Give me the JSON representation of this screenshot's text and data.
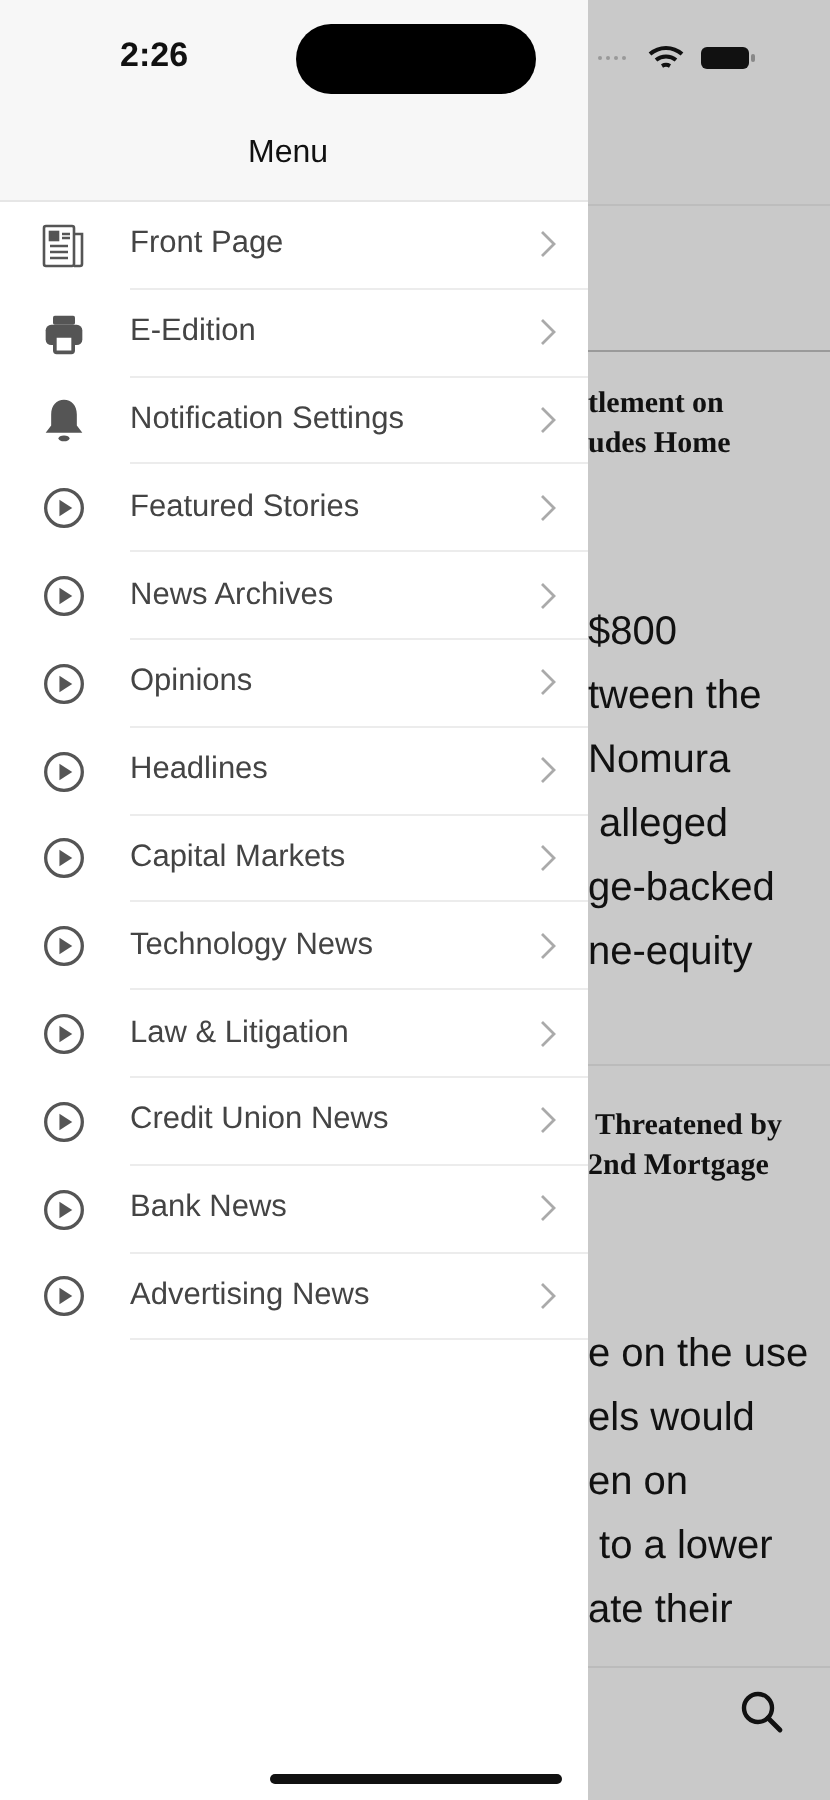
{
  "status_bar": {
    "time": "2:26"
  },
  "menu": {
    "title": "Menu",
    "items": [
      {
        "label": "Front Page",
        "kind": "newspaper"
      },
      {
        "label": "E-Edition",
        "kind": "printer"
      },
      {
        "label": "Notification Settings",
        "kind": "bell"
      },
      {
        "label": "Featured Stories",
        "kind": "play"
      },
      {
        "label": "News Archives",
        "kind": "play"
      },
      {
        "label": "Opinions",
        "kind": "play"
      },
      {
        "label": "Headlines",
        "kind": "play"
      },
      {
        "label": "Capital Markets",
        "kind": "play"
      },
      {
        "label": "Technology News",
        "kind": "play"
      },
      {
        "label": "Law & Litigation",
        "kind": "play"
      },
      {
        "label": "Credit Union News",
        "kind": "play"
      },
      {
        "label": "Bank News",
        "kind": "play"
      },
      {
        "label": "Advertising News",
        "kind": "play"
      }
    ]
  },
  "articles": [
    {
      "headline": [
        "tlement on",
        "udes Home"
      ],
      "body": [
        "$800",
        "tween the",
        "Nomura",
        " alleged",
        "ge-backed",
        "ne-equity"
      ]
    },
    {
      "headline": [
        " Threatened by",
        "2nd Mortgage"
      ],
      "body": [
        "e on the use",
        "els would",
        "en on",
        " to a lower",
        "ate their"
      ]
    }
  ]
}
